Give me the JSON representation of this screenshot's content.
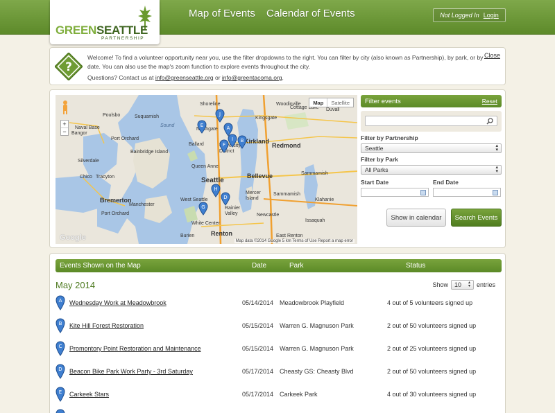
{
  "header": {
    "logo": {
      "main_green": "GREEN",
      "main_dark": "SEATTLE",
      "sub": "PARTNERSHIP"
    },
    "nav": [
      "Map of Events",
      "Calendar of Events"
    ],
    "login_status": "Not Logged In",
    "login_link": "Login"
  },
  "welcome": {
    "line1": "Welcome! To find a volunteer opportunity near you, use the filter dropdowns to the right. You can filter by city (also known as Partnership), by park, or by date. You can also use the map's zoom function to explore events throughout the city.",
    "contact_prefix": "Questions? Contact us at",
    "email1": "info@greenseattle.org",
    "or": "or",
    "email2": "info@greentacoma.org",
    "period": ".",
    "close": "Close"
  },
  "map": {
    "type_map": "Map",
    "type_satellite": "Satellite",
    "zoom_in": "+",
    "zoom_out": "−",
    "footer": "Map data ©2014 Google   5 km   Terms of Use   Report a map error",
    "google": "Google",
    "places": {
      "poulsbo": "Poulsbo",
      "shoreline": "Shoreline",
      "woodinville": "Woodinville",
      "cottage_lake": "Cottage Lake",
      "duvall": "Duvall",
      "suquamish": "Suquamish",
      "northgate": "Northgate",
      "kingsgate": "Kingsgate",
      "sound": "Sound",
      "naval_base": "Naval Base",
      "bangor": "Bangor",
      "port_orchard": "Port Orchard",
      "kirkland": "Kirkland",
      "redmond": "Redmond",
      "bainbridge": "Bainbridge Island",
      "ballard": "Ballard",
      "university_district": "University District",
      "silverdale": "Silverdale",
      "queen_anne": "Queen Anne",
      "chico": "Chico",
      "tracyton": "Tracyton",
      "seattle": "Seattle",
      "bellevue": "Bellevue",
      "sammamish": "Sammamish",
      "bremerton": "Bremerton",
      "manchester": "Manchester",
      "west_seattle": "West Seattle",
      "mercer_island": "Mercer Island",
      "issaquah": "Issaquah",
      "port_orchard2": "Port Orchard",
      "newcastle": "Newcastle",
      "renton": "Renton",
      "white_center": "White Center",
      "burien": "Burien",
      "rainier_valley": "Rainier Valley",
      "klahanie": "Klahanie",
      "east_renton": "East Renton"
    }
  },
  "filter": {
    "title": "Filter events",
    "reset": "Reset",
    "search_placeholder": "",
    "partnership_label": "Filter by Partnership",
    "partnership_value": "Seattle",
    "park_label": "Filter by Park",
    "park_value": "All Parks",
    "start_date_label": "Start Date",
    "end_date_label": "End Date",
    "show_calendar": "Show in calendar",
    "search_events": "Search Events"
  },
  "events": {
    "columns": [
      "Events Shown on the Map",
      "Date",
      "Park",
      "Status"
    ],
    "month": "May 2014",
    "show_label": "Show",
    "entries_value": "10",
    "entries_label": "entries",
    "rows": [
      {
        "marker": "A",
        "name": "Wednesday Work at Meadowbrook",
        "date": "05/14/2014",
        "park": "Meadowbrook Playfield",
        "status": "4 out of 5 volunteers signed up"
      },
      {
        "marker": "B",
        "name": "Kite Hill Forest Restoration",
        "date": "05/15/2014",
        "park": "Warren G. Magnuson Park",
        "status": "2 out of 50 volunteers signed up"
      },
      {
        "marker": "C",
        "name": "Promontory Point Restoration and Maintenance",
        "date": "05/15/2014",
        "park": "Warren G. Magnuson Park",
        "status": "2 out of 25 volunteers signed up"
      },
      {
        "marker": "D",
        "name": "Beacon Bike Park Work Party - 3rd Saturday",
        "date": "05/17/2014",
        "park": "Cheasty GS: Cheasty Blvd",
        "status": "2 out of 50 volunteers signed up"
      },
      {
        "marker": "E",
        "name": "Carkeek Stars",
        "date": "05/17/2014",
        "park": "Carkeek Park",
        "status": "4 out of 30 volunteers signed up"
      }
    ]
  },
  "colors": {
    "brand_green": "#5d8a2a",
    "marker_blue": "#3f7fd0",
    "background": "#f4f1e6"
  }
}
